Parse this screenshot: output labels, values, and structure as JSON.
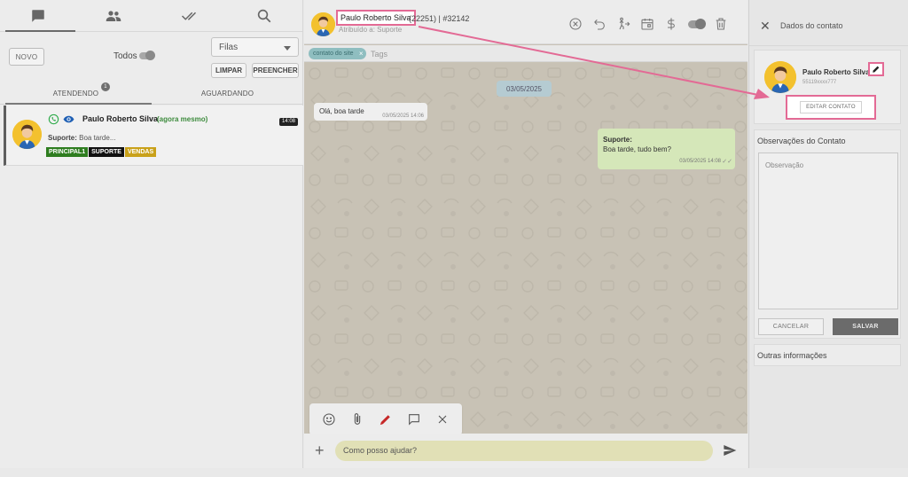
{
  "left": {
    "tabs": [
      {
        "icon": "chat-icon"
      },
      {
        "icon": "people-icon"
      },
      {
        "icon": "double-check-icon"
      },
      {
        "icon": "search-icon"
      }
    ],
    "novo_label": "NOVO",
    "todos_label": "Todos",
    "filas_placeholder": "Filas",
    "limpar_label": "LIMPAR",
    "preencher_label": "PREENCHER",
    "status_tabs": [
      {
        "label": "ATENDENDO",
        "badge": "1"
      },
      {
        "label": "AGUARDANDO"
      }
    ],
    "ticket": {
      "name": "Paulo Roberto Silva",
      "time_relative": "(agora mesmo)",
      "time": "14:08",
      "last_sender": "Suporte:",
      "last_message": "Boa tarde...",
      "tags": [
        {
          "label": "PRINCIPAL1",
          "color": "#2e7d1f"
        },
        {
          "label": "SUPORTE",
          "color": "#111111"
        },
        {
          "label": "VENDAS",
          "color": "#c9a11a"
        }
      ]
    }
  },
  "chat": {
    "contact_name": "Paulo Roberto Silva",
    "meta": "(22251) | #32142",
    "assigned": "Atribuído a: Suporte",
    "chip": "contato do site",
    "tags_placeholder": "Tags",
    "date": "03/05/2025",
    "messages": [
      {
        "direction": "in",
        "text": "Olá, boa tarde",
        "time": "03/05/2025 14:06"
      },
      {
        "direction": "out",
        "sender": "Suporte:",
        "text": "Boa tarde, tudo bem?",
        "time": "03/05/2025 14:08"
      }
    ],
    "input_value": "Como posso ajudar?"
  },
  "right": {
    "title": "Dados do contato",
    "name": "Paulo Roberto Silva",
    "phone": "55119xxxx777",
    "editar_label": "EDITAR CONTATO",
    "obs_title": "Observações do Contato",
    "obs_placeholder": "Observação",
    "cancel_label": "CANCELAR",
    "save_label": "SALVAR",
    "outras_label": "Outras informações"
  },
  "colors": {
    "highlight": "#e36a95",
    "incoming_bubble": "#efefef",
    "outgoing_bubble": "#d5e7b9",
    "chat_bg": "#c8c2b5"
  }
}
